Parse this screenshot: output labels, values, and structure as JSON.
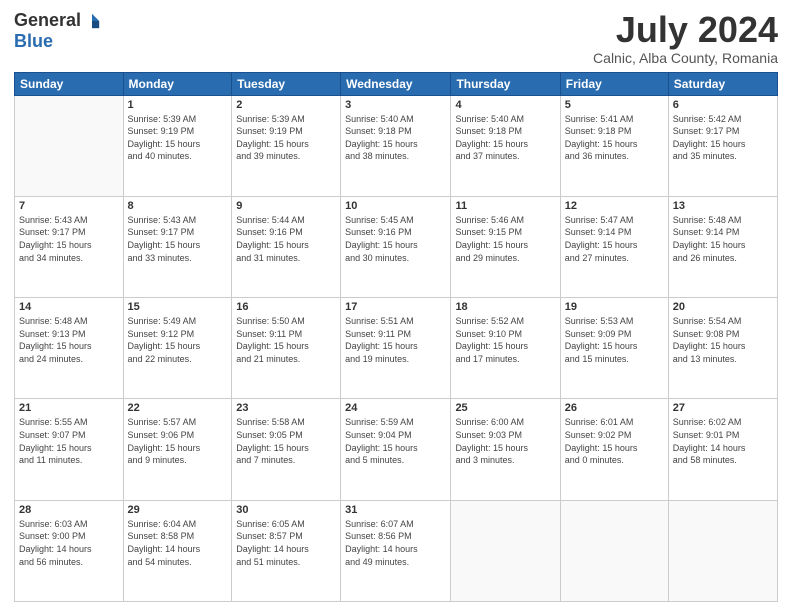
{
  "logo": {
    "general": "General",
    "blue": "Blue"
  },
  "header": {
    "month_year": "July 2024",
    "location": "Calnic, Alba County, Romania"
  },
  "weekdays": [
    "Sunday",
    "Monday",
    "Tuesday",
    "Wednesday",
    "Thursday",
    "Friday",
    "Saturday"
  ],
  "weeks": [
    [
      {
        "day": "",
        "info": ""
      },
      {
        "day": "1",
        "info": "Sunrise: 5:39 AM\nSunset: 9:19 PM\nDaylight: 15 hours\nand 40 minutes."
      },
      {
        "day": "2",
        "info": "Sunrise: 5:39 AM\nSunset: 9:19 PM\nDaylight: 15 hours\nand 39 minutes."
      },
      {
        "day": "3",
        "info": "Sunrise: 5:40 AM\nSunset: 9:18 PM\nDaylight: 15 hours\nand 38 minutes."
      },
      {
        "day": "4",
        "info": "Sunrise: 5:40 AM\nSunset: 9:18 PM\nDaylight: 15 hours\nand 37 minutes."
      },
      {
        "day": "5",
        "info": "Sunrise: 5:41 AM\nSunset: 9:18 PM\nDaylight: 15 hours\nand 36 minutes."
      },
      {
        "day": "6",
        "info": "Sunrise: 5:42 AM\nSunset: 9:17 PM\nDaylight: 15 hours\nand 35 minutes."
      }
    ],
    [
      {
        "day": "7",
        "info": "Sunrise: 5:43 AM\nSunset: 9:17 PM\nDaylight: 15 hours\nand 34 minutes."
      },
      {
        "day": "8",
        "info": "Sunrise: 5:43 AM\nSunset: 9:17 PM\nDaylight: 15 hours\nand 33 minutes."
      },
      {
        "day": "9",
        "info": "Sunrise: 5:44 AM\nSunset: 9:16 PM\nDaylight: 15 hours\nand 31 minutes."
      },
      {
        "day": "10",
        "info": "Sunrise: 5:45 AM\nSunset: 9:16 PM\nDaylight: 15 hours\nand 30 minutes."
      },
      {
        "day": "11",
        "info": "Sunrise: 5:46 AM\nSunset: 9:15 PM\nDaylight: 15 hours\nand 29 minutes."
      },
      {
        "day": "12",
        "info": "Sunrise: 5:47 AM\nSunset: 9:14 PM\nDaylight: 15 hours\nand 27 minutes."
      },
      {
        "day": "13",
        "info": "Sunrise: 5:48 AM\nSunset: 9:14 PM\nDaylight: 15 hours\nand 26 minutes."
      }
    ],
    [
      {
        "day": "14",
        "info": "Sunrise: 5:48 AM\nSunset: 9:13 PM\nDaylight: 15 hours\nand 24 minutes."
      },
      {
        "day": "15",
        "info": "Sunrise: 5:49 AM\nSunset: 9:12 PM\nDaylight: 15 hours\nand 22 minutes."
      },
      {
        "day": "16",
        "info": "Sunrise: 5:50 AM\nSunset: 9:11 PM\nDaylight: 15 hours\nand 21 minutes."
      },
      {
        "day": "17",
        "info": "Sunrise: 5:51 AM\nSunset: 9:11 PM\nDaylight: 15 hours\nand 19 minutes."
      },
      {
        "day": "18",
        "info": "Sunrise: 5:52 AM\nSunset: 9:10 PM\nDaylight: 15 hours\nand 17 minutes."
      },
      {
        "day": "19",
        "info": "Sunrise: 5:53 AM\nSunset: 9:09 PM\nDaylight: 15 hours\nand 15 minutes."
      },
      {
        "day": "20",
        "info": "Sunrise: 5:54 AM\nSunset: 9:08 PM\nDaylight: 15 hours\nand 13 minutes."
      }
    ],
    [
      {
        "day": "21",
        "info": "Sunrise: 5:55 AM\nSunset: 9:07 PM\nDaylight: 15 hours\nand 11 minutes."
      },
      {
        "day": "22",
        "info": "Sunrise: 5:57 AM\nSunset: 9:06 PM\nDaylight: 15 hours\nand 9 minutes."
      },
      {
        "day": "23",
        "info": "Sunrise: 5:58 AM\nSunset: 9:05 PM\nDaylight: 15 hours\nand 7 minutes."
      },
      {
        "day": "24",
        "info": "Sunrise: 5:59 AM\nSunset: 9:04 PM\nDaylight: 15 hours\nand 5 minutes."
      },
      {
        "day": "25",
        "info": "Sunrise: 6:00 AM\nSunset: 9:03 PM\nDaylight: 15 hours\nand 3 minutes."
      },
      {
        "day": "26",
        "info": "Sunrise: 6:01 AM\nSunset: 9:02 PM\nDaylight: 15 hours\nand 0 minutes."
      },
      {
        "day": "27",
        "info": "Sunrise: 6:02 AM\nSunset: 9:01 PM\nDaylight: 14 hours\nand 58 minutes."
      }
    ],
    [
      {
        "day": "28",
        "info": "Sunrise: 6:03 AM\nSunset: 9:00 PM\nDaylight: 14 hours\nand 56 minutes."
      },
      {
        "day": "29",
        "info": "Sunrise: 6:04 AM\nSunset: 8:58 PM\nDaylight: 14 hours\nand 54 minutes."
      },
      {
        "day": "30",
        "info": "Sunrise: 6:05 AM\nSunset: 8:57 PM\nDaylight: 14 hours\nand 51 minutes."
      },
      {
        "day": "31",
        "info": "Sunrise: 6:07 AM\nSunset: 8:56 PM\nDaylight: 14 hours\nand 49 minutes."
      },
      {
        "day": "",
        "info": ""
      },
      {
        "day": "",
        "info": ""
      },
      {
        "day": "",
        "info": ""
      }
    ]
  ]
}
